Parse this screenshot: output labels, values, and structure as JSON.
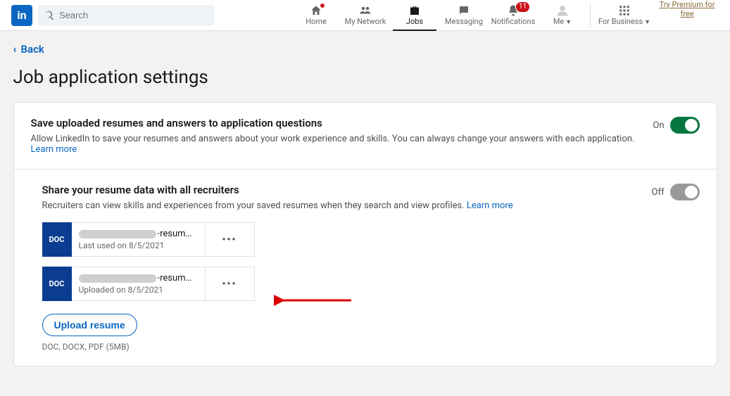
{
  "search": {
    "placeholder": "Search"
  },
  "nav": {
    "home": "Home",
    "network": "My Network",
    "jobs": "Jobs",
    "messaging": "Messaging",
    "notifications": "Notifications",
    "notif_badge": "11",
    "me": "Me",
    "business": "For Business",
    "premium": "Try Premium for free"
  },
  "back": "Back",
  "title": "Job application settings",
  "s1": {
    "title": "Save uploaded resumes and answers to application questions",
    "desc": "Allow LinkedIn to save your resumes and answers about your work experience and skills. You can always change your answers with each application. ",
    "learn": "Learn more",
    "state": "On"
  },
  "s2": {
    "title": "Share your resume data with all recruiters",
    "desc": "Recruiters can view skills and experiences from your saved resumes when they search and view profiles. ",
    "learn": "Learn more",
    "state": "Off"
  },
  "resumes": {
    "doc_label": "DOC",
    "r1": {
      "name_suffix": "-resum…",
      "meta": "Last used on 8/5/2021"
    },
    "r2": {
      "name_suffix": "-resum…",
      "meta": "Uploaded on 8/5/2021"
    }
  },
  "upload": {
    "btn": "Upload resume",
    "hint": "DOC, DOCX, PDF (5MB)"
  }
}
